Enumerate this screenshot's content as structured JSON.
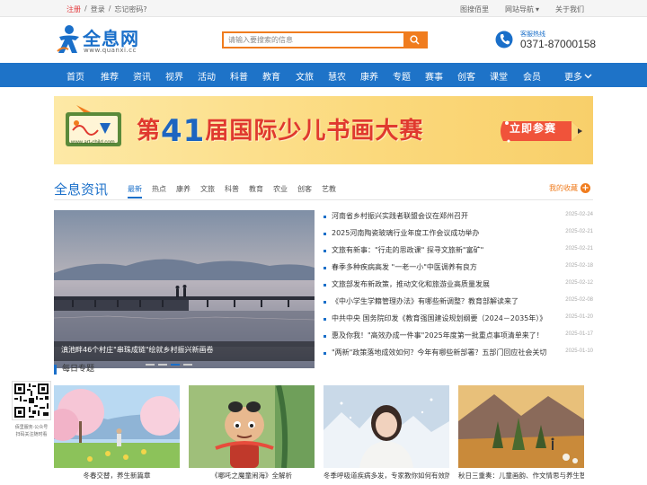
{
  "topbar": {
    "register": "注册",
    "sep1": "/",
    "login": "登录",
    "sep2": "/",
    "forgot": "忘记密码?",
    "links": [
      "图搜佰里",
      "网站导航",
      "关于我们"
    ]
  },
  "header": {
    "logo_name": "全息网",
    "logo_url": "www.quanxi.cc",
    "search_placeholder": "请输入要搜索的信息",
    "hotline_label": "客服热线",
    "hotline_number": "0371-87000158"
  },
  "nav": {
    "items": [
      "首页",
      "推荐",
      "资讯",
      "视界",
      "活动",
      "科普",
      "教育",
      "文旅",
      "慧农",
      "康养",
      "专题",
      "赛事",
      "创客",
      "课堂",
      "会员"
    ],
    "more": "更多"
  },
  "banner": {
    "site": "www.art-child.com",
    "title_pre": "第",
    "title_num": "41",
    "title_post": "届国际少儿书画大赛",
    "cta": "立即参赛"
  },
  "section": {
    "title": "全息资讯",
    "tabs": [
      "最新",
      "热点",
      "康养",
      "文旅",
      "科普",
      "教育",
      "农业",
      "创客",
      "艺教"
    ],
    "favorites": "我的收藏"
  },
  "feature": {
    "caption": "滇池畔46个村庄\"串珠成链\"绘就乡村振兴新画卷"
  },
  "news": [
    {
      "title": "河南省乡村振兴实践者联盟会议在郑州召开",
      "date": "2025-02-24"
    },
    {
      "title": "2025河南陶瓷玻璃行业年度工作会议成功举办",
      "date": "2025-02-21"
    },
    {
      "title": "文旅有新事：\"行走的思政课\" 探寻文旅新\"富矿\"",
      "date": "2025-02-21"
    },
    {
      "title": "春季多种疾病高发 \"一老一小\"中医调养有良方",
      "date": "2025-02-18"
    },
    {
      "title": "文旅部发布新政策，推动文化和旅游业高质量发展",
      "date": "2025-02-12"
    },
    {
      "title": "《中小学生学籍管理办法》有哪些新调整？教育部解读来了",
      "date": "2025-02-08"
    },
    {
      "title": "中共中央 国务院印发《教育强国建设规划纲要（2024－2035年）》",
      "date": "2025-01-20"
    },
    {
      "title": "惠及你我！\"高效办成一件事\"2025年度第一批重点事项清单来了！",
      "date": "2025-01-17"
    },
    {
      "title": "\"两新\"政策落地成效如何？今年有哪些新部署？五部门回应社会关切",
      "date": "2025-01-10"
    }
  ],
  "daily": {
    "title": "每日专题",
    "cards": [
      {
        "caption": "冬春交替，养生新篇章"
      },
      {
        "caption": "《哪吒之魔童闹海》全解析"
      },
      {
        "caption": "冬季呼吸道疾病多发，专家教你如何有效防范"
      },
      {
        "caption": "秋日三重奏：儿童画韵、作文情思与养生智慧"
      }
    ]
  },
  "qr": {
    "line1": "佰里服务·公众号",
    "line2": "扫码关注随时看"
  }
}
